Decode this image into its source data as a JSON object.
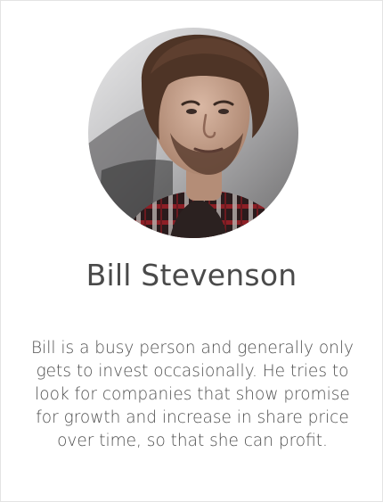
{
  "profile": {
    "name": "Bill Stevenson",
    "bio": "Bill is a busy person and generally only gets to invest occasionally. He tries to look for companies that show promise for growth and increase in share price over time, so that she can profit.",
    "avatar_icon": "avatar-photo"
  },
  "colors": {
    "text": "#4a4a4a",
    "card_border": "#e3e3e3",
    "background": "#ffffff"
  }
}
